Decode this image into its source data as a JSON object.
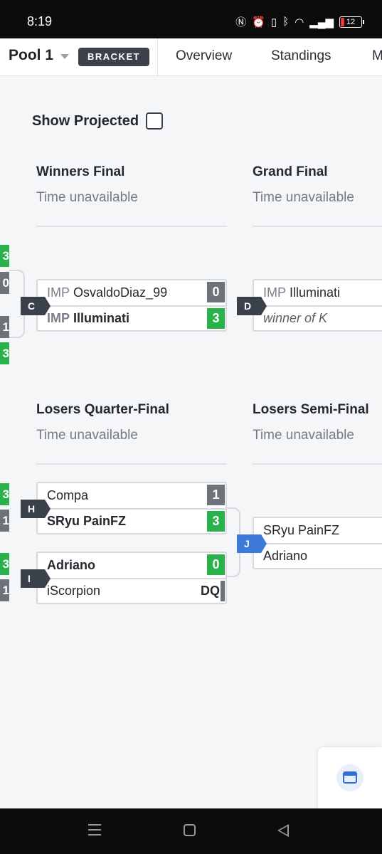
{
  "status_bar": {
    "time": "8:19",
    "battery": "12"
  },
  "header": {
    "pool_label": "Pool 1",
    "bracket_badge": "BRACKET",
    "tabs": [
      "Overview",
      "Standings",
      "M"
    ]
  },
  "show_projected": {
    "label": "Show Projected",
    "checked": false
  },
  "rounds": {
    "winners_final": {
      "title": "Winners Final",
      "time": "Time unavailable"
    },
    "grand_final": {
      "title": "Grand Final",
      "time": "Time unavailable"
    },
    "losers_quarter_final": {
      "title": "Losers Quarter-Final",
      "time": "Time unavailable"
    },
    "losers_semi_final": {
      "title": "Losers Semi-Final",
      "time": "Time unavailable"
    }
  },
  "sets": {
    "C": {
      "id": "C",
      "p1": {
        "prefix": "IMP",
        "name": "OsvaldoDiaz_99",
        "score": "0",
        "winner": false
      },
      "p2": {
        "prefix": "IMP",
        "name": "Illuminati",
        "score": "3",
        "winner": true
      }
    },
    "D": {
      "id": "D",
      "p1": {
        "prefix": "IMP",
        "name": "Illuminati"
      },
      "p2": {
        "name": "winner of K"
      }
    },
    "H": {
      "id": "H",
      "p1": {
        "name": "Compa",
        "score": "1",
        "winner": false
      },
      "p2": {
        "name": "SRyu PainFZ",
        "score": "3",
        "winner": true
      }
    },
    "I": {
      "id": "I",
      "p1": {
        "name": "Adriano",
        "score": "0",
        "winner": true
      },
      "p2": {
        "name": "iScorpion",
        "score": "DQ",
        "winner": false
      }
    },
    "J": {
      "id": "J",
      "p1": {
        "name": "SRyu PainFZ"
      },
      "p2": {
        "name": "Adriano"
      }
    }
  },
  "edge_scores": [
    "3",
    "0",
    "1",
    "3",
    "3",
    "1",
    "3",
    "1"
  ],
  "colors": {
    "win": "#2ab24a",
    "lose": "#6c737b",
    "tag": "#3a414b",
    "tag_active": "#3d7ad8"
  }
}
